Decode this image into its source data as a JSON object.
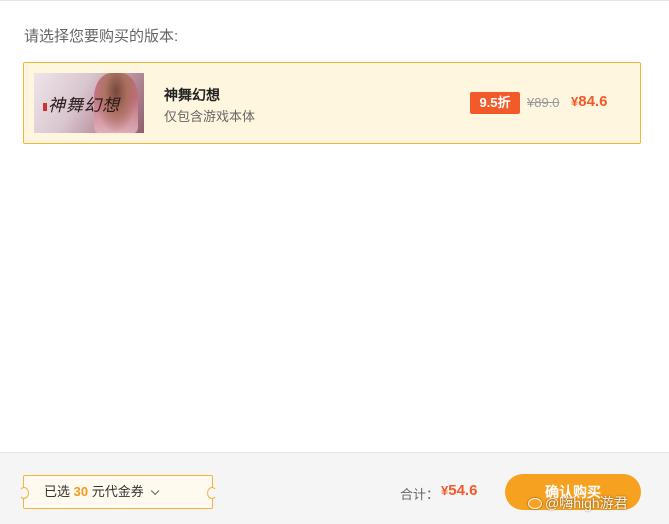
{
  "prompt": "请选择您要购买的版本:",
  "edition": {
    "cover_logo": "神舞幻想",
    "title": "神舞幻想",
    "subtitle": "仅包含游戏本体",
    "discount": "9.5折",
    "original_price": "¥89.0",
    "sale_currency": "¥",
    "sale_amount": "84.6"
  },
  "footer": {
    "coupon_prefix": "已选",
    "coupon_amount": "30",
    "coupon_suffix": "元代金券",
    "total_label": "合计：",
    "total_currency": "¥",
    "total_amount": "54.6",
    "confirm_label": "确认购买"
  },
  "watermark": "@嗨high游君",
  "colors": {
    "accent_orange": "#f7a120",
    "price_red": "#f25a2a",
    "card_border": "#f2b53a",
    "card_bg": "#fff6e0"
  }
}
